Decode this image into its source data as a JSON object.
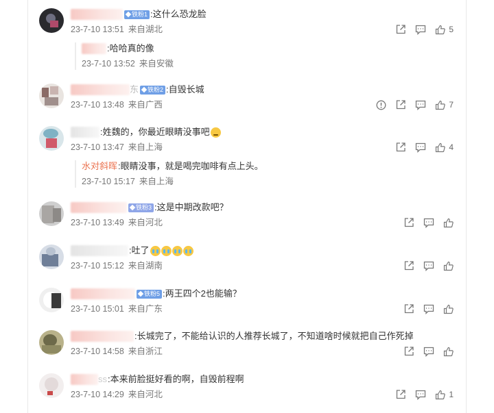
{
  "comments": [
    {
      "text": ":这什么恐龙脸",
      "badge": "铁粉1",
      "time": "23-7-10 13:51",
      "location": "来自湖北",
      "likes": "5",
      "reply": {
        "text": ":哈哈真的像",
        "time": "23-7-10 13:52",
        "location": "来自安徽"
      }
    },
    {
      "text": ":自毁长城",
      "name_tail": "东",
      "badge": "铁粉2",
      "time": "23-7-10 13:48",
      "location": "来自广西",
      "likes": "7"
    },
    {
      "text": ":姓魏的，你最近眼睛没事吧",
      "time": "23-7-10 13:47",
      "location": "来自上海",
      "likes": "4",
      "reply": {
        "name": "水对斜晖",
        "text": ":眼睛没事，就是喝完咖啡有点上头。",
        "time": "23-7-10 15:17",
        "location": "来自上海"
      }
    },
    {
      "text": ":这是中期改款吧？",
      "badge": "铁粉3",
      "time": "23-7-10 13:49",
      "location": "来自河北"
    },
    {
      "text": ":吐了",
      "time": "23-7-10 15:12",
      "location": "来自湖南"
    },
    {
      "text": ":两王四个2也能输？",
      "badge": "铁粉5",
      "time": "23-7-10 15:01",
      "location": "来自广东"
    },
    {
      "text": ":长城完了，不能给认识的人推荐长城了，不知道啥时候就把自己作死掉",
      "time": "23-7-10 14:58",
      "location": "来自浙江"
    },
    {
      "text": ":本来前脸挺好看的啊，自毁前程啊",
      "name_tail": "ss",
      "time": "23-7-10 14:29",
      "location": "来自河北",
      "likes": "1"
    }
  ],
  "icons": {
    "share": "share-icon",
    "comment": "comment-icon",
    "like": "thumbs-up-icon",
    "report": "report-icon"
  },
  "colors": {
    "name_link": "#eb7350",
    "badge_bg": "#6f9fe6",
    "meta_text": "#777777"
  }
}
